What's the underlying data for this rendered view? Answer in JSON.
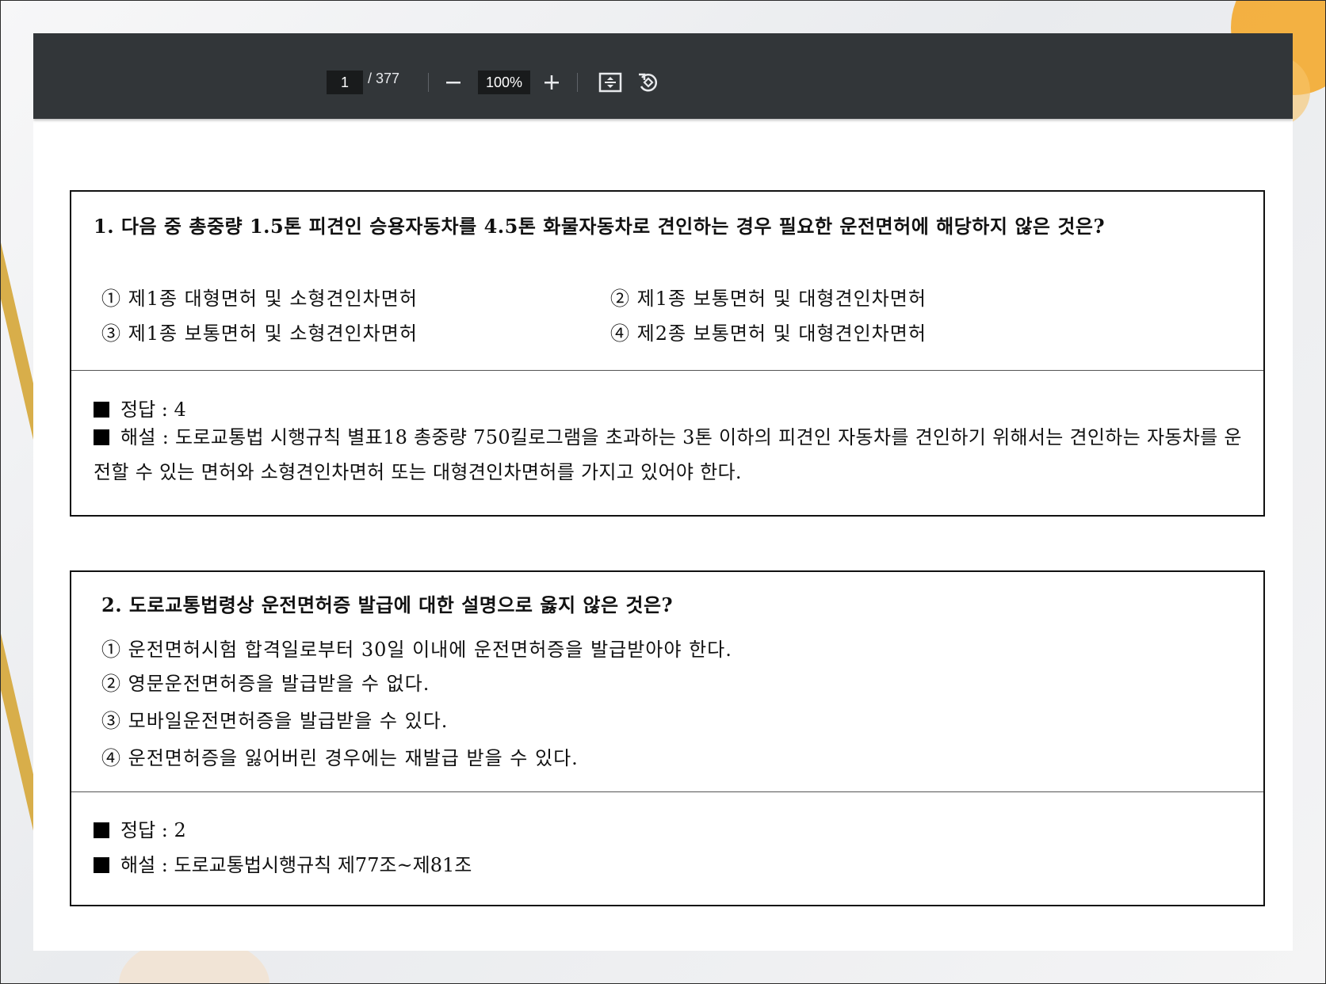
{
  "toolbar": {
    "page_current": "1",
    "page_total": "/ 377",
    "zoom": "100%",
    "zoom_out_icon": "minus-icon",
    "zoom_in_icon": "plus-icon",
    "fit_icon": "fit-to-page-icon",
    "rotate_icon": "rotate-icon"
  },
  "q1": {
    "title": "1. 다음 중 총중량 1.5톤 피견인 승용자동차를 4.5톤 화물자동차로 견인하는 경우 필요한 운전면허에 해당하지 않은 것은?",
    "options": [
      "① 제1종 대형면허 및 소형견인차면허",
      "② 제1종 보통면허 및 대형견인차면허",
      "③ 제1종 보통면허 및 소형견인차면허",
      "④ 제2종 보통면허 및 대형견인차면허"
    ],
    "answer": "정답 : 4",
    "explanation": "해설 : 도로교통법 시행규칙 별표18 총중량 750킬로그램을 초과하는 3톤 이하의 피견인 자동차를 견인하기 위해서는 견인하는 자동차를 운전할 수 있는 면허와 소형견인차면허 또는 대형견인차면허를 가지고 있어야 한다."
  },
  "q2": {
    "title": "2. 도로교통법령상 운전면허증 발급에 대한 설명으로 옳지 않은 것은?",
    "options": [
      "① 운전면허시험 합격일로부터 30일 이내에 운전면허증을 발급받아야 한다.",
      "② 영문운전면허증을 발급받을 수 없다.",
      "③ 모바일운전면허증을 발급받을 수 있다.",
      "④ 운전면허증을 잃어버린 경우에는 재발급 받을 수 있다."
    ],
    "answer": "정답 : 2",
    "explanation": "해설 : 도로교통법시행규칙 제77조~제81조"
  }
}
